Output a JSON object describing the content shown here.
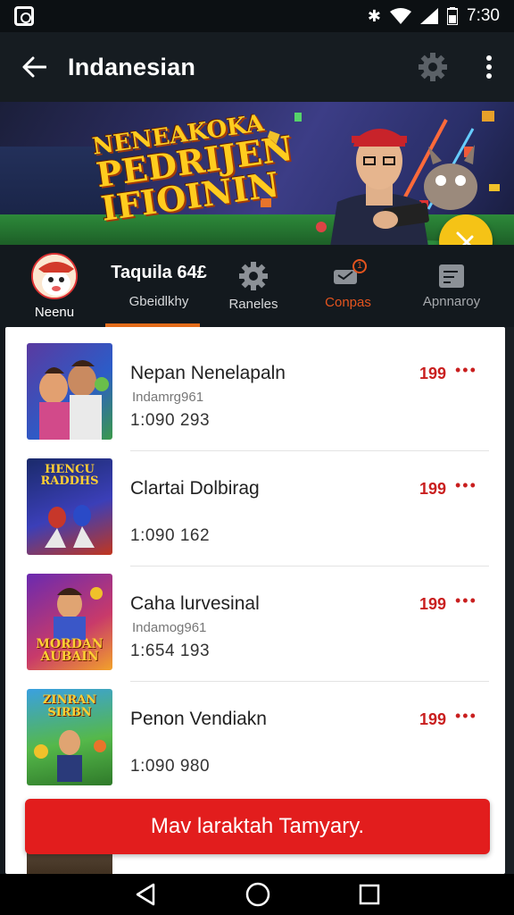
{
  "status_bar": {
    "time": "7:30"
  },
  "app_bar": {
    "title": "Indanesian"
  },
  "banner": {
    "line1": "NENEAKOKA",
    "line2": "PEDRIJEN",
    "line3": "IFIOININ"
  },
  "tabs": [
    {
      "label": "Neenu"
    },
    {
      "title": "Taquila 64£",
      "label": "Gbeidlkhy"
    },
    {
      "label": "Raneles"
    },
    {
      "label": "Conpas",
      "badge": "1"
    },
    {
      "label": "Apnnaroy"
    }
  ],
  "items": [
    {
      "name": "Nepan Nenelapaln",
      "sub": "Indamrg961",
      "number": "1:090 293",
      "price": "199",
      "thumb_title": ""
    },
    {
      "name": "Clartai Dolbirag",
      "sub": "",
      "number": "1:090 162",
      "price": "199",
      "thumb_title": "HENCU RADDHS"
    },
    {
      "name": "Caha lurvesinal",
      "sub": "Indamog961",
      "number": "1:654 193",
      "price": "199",
      "thumb_title": "MORDAN AUBAIN"
    },
    {
      "name": "Penon Vendiakn",
      "sub": "",
      "number": "1:090 980",
      "price": "199",
      "thumb_title": "ZINRAN SIRBN"
    }
  ],
  "cta": {
    "label": "Mav laraktah Tamyary."
  },
  "colors": {
    "accent": "#e21d1d",
    "tab_underline": "#e36c1a",
    "fab": "#f5c316",
    "price": "#c91f1f"
  }
}
